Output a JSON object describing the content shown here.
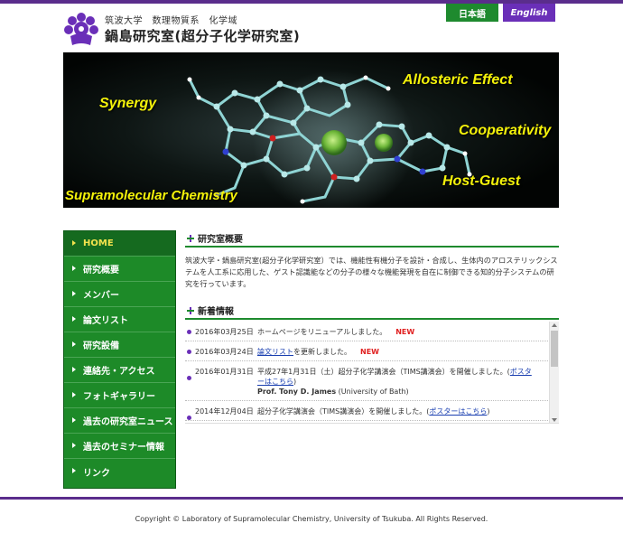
{
  "header": {
    "university_line": "筑波大学　数理物質系　化学域",
    "lab_name": "鍋島研究室(超分子化学研究室)",
    "lang_ja": "日本語",
    "lang_en": "English"
  },
  "banner": {
    "labels": {
      "synergy": "Synergy",
      "allosteric": "Allosteric Effect",
      "cooperativity": "Cooperativity",
      "hostguest": "Host-Guest",
      "supramolecular": "Supramolecular Chemistry"
    }
  },
  "sidebar": {
    "items": [
      {
        "label": "HOME"
      },
      {
        "label": "研究概要"
      },
      {
        "label": "メンバー"
      },
      {
        "label": "論文リスト"
      },
      {
        "label": "研究設備"
      },
      {
        "label": "連絡先・アクセス"
      },
      {
        "label": "フォトギャラリー"
      },
      {
        "label": "過去の研究室ニュース"
      },
      {
        "label": "過去のセミナー情報"
      },
      {
        "label": "リンク"
      }
    ]
  },
  "overview": {
    "title": "研究室概要",
    "text": "筑波大学・鍋島研究室(超分子化学研究室）では、機能性有機分子を設計・合成し、生体内のアロステリックシステムを人工系に応用した、ゲスト認識能などの分子の様々な機能発現を自在に制御できる知的分子システムの研究を行っています。"
  },
  "news": {
    "title": "新着情報",
    "items": [
      {
        "date": "2016年03月25日",
        "text": "ホームページをリニューアルしました。",
        "new_label": "NEW"
      },
      {
        "date": "2016年03月24日",
        "link": "論文リスト",
        "text": "を更新しました。",
        "new_label": "NEW"
      },
      {
        "date": "2016年01月31日",
        "text": "平成27年1月31日（土）超分子化学講演会（TIMS講演会）を開催しました。(",
        "link": "ポスターはこちら",
        "text_end": ")",
        "speaker": "Prof. Tony D. James",
        "affiliation": " (University of Bath)"
      },
      {
        "date": "2014年12月04日",
        "text": "超分子化学講演会（TIMS講演会）を開催しました。(",
        "link": "ポスターはこちら",
        "text_end": ")"
      }
    ]
  },
  "footer": {
    "copyright": "Copyright © Laboratory of Supramolecular Chemistry, University of Tsukuba. All Rights Reserved."
  },
  "colors": {
    "brand_purple": "#5a2d8c",
    "nav_green": "#1d8a28",
    "accent_yellow": "#f3e24d",
    "new_red": "#e02020"
  }
}
